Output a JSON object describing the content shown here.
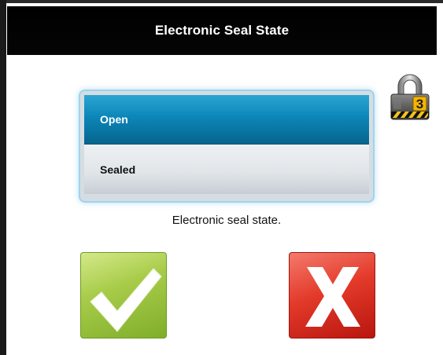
{
  "dialog": {
    "title": "Electronic Seal State",
    "caption": "Electronic seal state.",
    "lock_level": "3"
  },
  "seal_options": [
    {
      "label": "Open",
      "selected": true
    },
    {
      "label": "Sealed",
      "selected": false
    }
  ],
  "buttons": {
    "confirm_icon": "checkmark-icon",
    "cancel_icon": "x-icon"
  },
  "colors": {
    "selected_option": "#0c86b8",
    "confirm": "#8cbf32",
    "cancel": "#e33a2a"
  }
}
